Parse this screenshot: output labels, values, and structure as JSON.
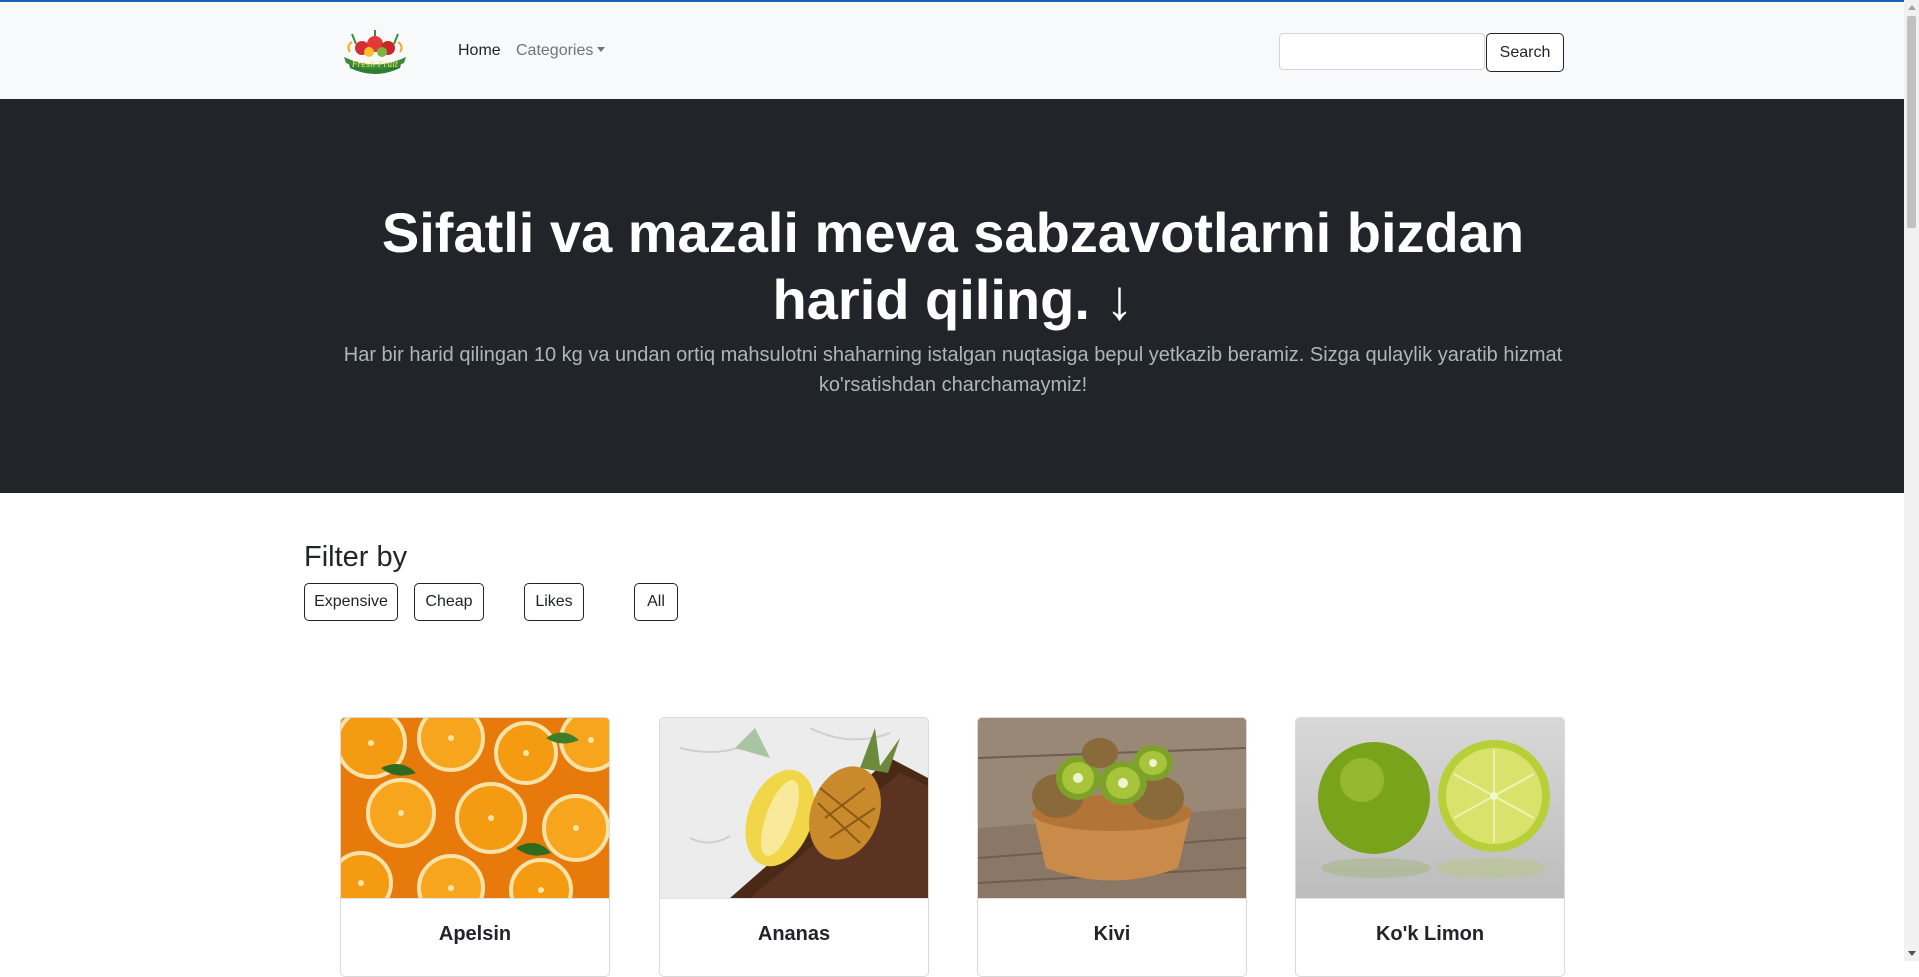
{
  "nav": {
    "home_label": "Home",
    "categories_label": "Categories",
    "search_placeholder": "",
    "search_button_label": "Search"
  },
  "hero": {
    "title_line1": "Sifatli va mazali meva sabzavotlarni bizdan",
    "title_line2": "harid qiling. ↓",
    "subtitle": "Har bir harid qilingan 10 kg va undan ortiq mahsulotni shaharning istalgan nuqtasiga bepul yetkazib beramiz. Sizga qulaylik yaratib hizmat ko'rsatishdan charchamaymiz!"
  },
  "filter": {
    "title": "Filter by",
    "buttons": [
      "Expensive",
      "Cheap",
      "Likes",
      "All"
    ]
  },
  "products": [
    {
      "name": "Apelsin",
      "image": "orange-slices-image"
    },
    {
      "name": "Ananas",
      "image": "pineapple-image"
    },
    {
      "name": "Kivi",
      "image": "kiwi-bowl-image"
    },
    {
      "name": "Ko'k Limon",
      "image": "lime-image"
    }
  ],
  "colors": {
    "accent_topline": "#1d5fb3",
    "hero_background": "#212529",
    "navbar_background": "#f8f9fa"
  }
}
